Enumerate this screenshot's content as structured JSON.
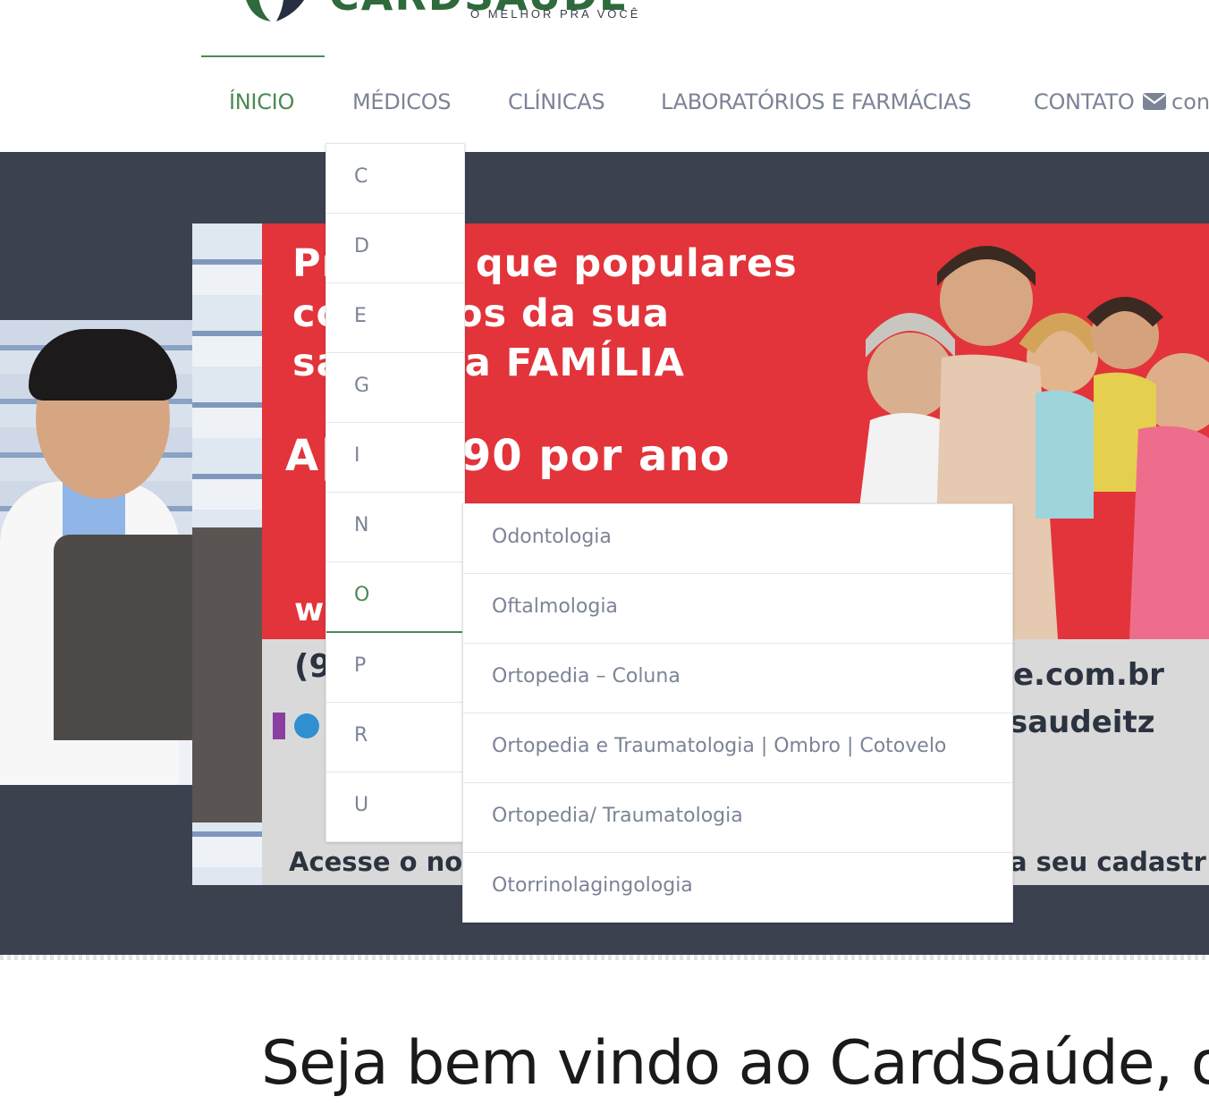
{
  "brand": {
    "name": "CARDSAÚDE",
    "tagline": "O MELHOR PRA VOCÊ",
    "colors": {
      "green": "#4a8a52",
      "nav": "#7b8496",
      "slider_bg": "#3c4150",
      "banner_red": "#e2343a"
    }
  },
  "nav": {
    "items": [
      {
        "label": "ÍNICIO",
        "active": true
      },
      {
        "label": "MÉDICOS",
        "active": false
      },
      {
        "label": "CLÍNICAS",
        "active": false
      },
      {
        "label": "LABORATÓRIOS E FARMÁCIAS",
        "active": false
      },
      {
        "label": "CONTATO",
        "active": false
      }
    ],
    "contact_icon": "envelope-icon",
    "contact_extra": "con"
  },
  "banner": {
    "line1": "Pr        mais que populares",
    "line2": "co        gastos da sua",
    "line3": "sa        desua FAMÍLIA",
    "line4": "A|        $29,90 por ano",
    "line5": "w",
    "phone": "(9",
    "site": "e.com.br",
    "social": "saudeitz",
    "cta_left": "Acesse o no",
    "cta_right": "a seu cadastr"
  },
  "letter_menu": {
    "items": [
      {
        "label": "C",
        "active": false
      },
      {
        "label": "D",
        "active": false
      },
      {
        "label": "E",
        "active": false
      },
      {
        "label": "G",
        "active": false
      },
      {
        "label": "I",
        "active": false
      },
      {
        "label": "N",
        "active": false
      },
      {
        "label": "O",
        "active": true
      },
      {
        "label": "P",
        "active": false
      },
      {
        "label": "R",
        "active": false
      },
      {
        "label": "U",
        "active": false
      }
    ]
  },
  "sub_menu": {
    "items": [
      "Odontologia",
      "Oftalmologia",
      "Ortopedia – Coluna",
      "Ortopedia e Traumatologia | Ombro | Cotovelo",
      "Ortopedia/ Traumatologia",
      "Otorrinolagingologia"
    ]
  },
  "welcome": {
    "heading": "Seja bem vindo ao CardSaúde, o"
  }
}
